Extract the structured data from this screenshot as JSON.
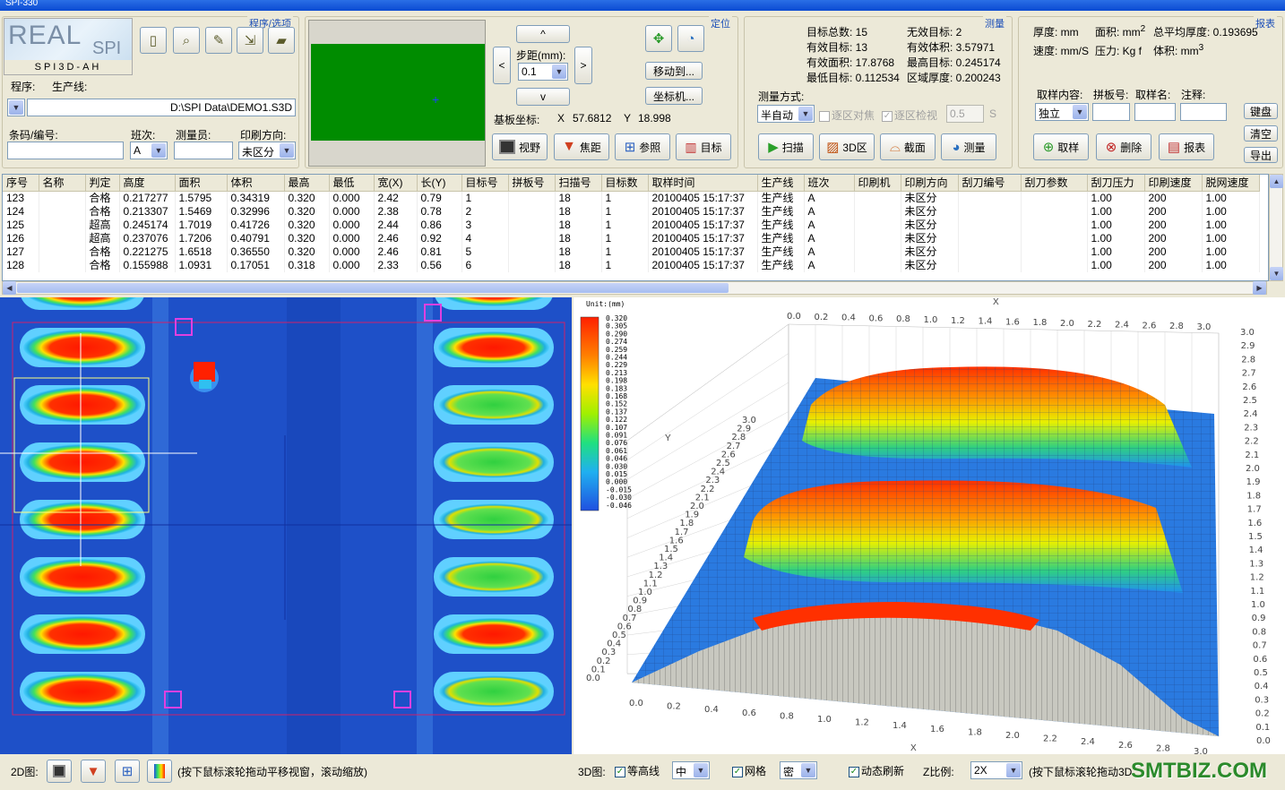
{
  "window": {
    "title": "SPI-330"
  },
  "program": {
    "group_title": "程序/选项",
    "logo_top": "REAL",
    "logo_small": "SPI",
    "model": "SPI3D-AH",
    "program_label": "程序:",
    "line_label": "生产线:",
    "path": "D:\\SPI Data\\DEMO1.S3D",
    "barcode_label": "条码/编号:",
    "shift_label": "班次:",
    "shift_value": "A",
    "operator_label": "测量员:",
    "print_dir_label": "印刷方向:",
    "print_dir_value": "未区分"
  },
  "position": {
    "group_title": "定位",
    "up": "^",
    "down": "v",
    "left": "<",
    "right": ">",
    "step_label": "步距(mm):",
    "step_value": "0.1",
    "move_to": "移动到...",
    "coord_machine": "坐标机...",
    "board_coord_label": "基板坐标:",
    "x_label": "X",
    "x_value": "57.6812",
    "y_label": "Y",
    "y_value": "18.998",
    "btn_view": "视野",
    "btn_focus": "焦距",
    "btn_ref": "参照",
    "btn_target": "目标"
  },
  "measure": {
    "group_title": "测量",
    "total_targets": "目标总数: 15",
    "invalid_targets": "无效目标: 2",
    "valid_targets": "有效目标: 13",
    "valid_volume": "有效体积: 3.57971",
    "valid_area": "有效面积: 17.8768",
    "max_target": "最高目标: 0.245174",
    "min_target": "最低目标: 0.112534",
    "region_thickness": "区域厚度: 0.200243",
    "mode_label": "测量方式:",
    "mode_value": "半自动",
    "chk_region_focus": "逐区对焦",
    "chk_region_check": "逐区检视",
    "time_value": "0.5",
    "time_unit": "S",
    "btn_scan": "扫描",
    "btn_3d": "3D区",
    "btn_section": "截面",
    "btn_measure": "测量"
  },
  "report": {
    "group_title": "报表",
    "thickness": "厚度: mm",
    "area": "面积: mm",
    "area_sup": "2",
    "avg_thickness": "总平均厚度: 0.193695",
    "speed": "速度: mm/S",
    "pressure": "压力: Kg f",
    "volume": "体积: mm",
    "volume_sup": "3",
    "sample_content_label": "取样内容:",
    "sample_content_value": "独立",
    "panel_no_label": "拼板号:",
    "sample_name_label": "取样名:",
    "note_label": "注释:",
    "btn_keyboard": "键盘",
    "btn_clear": "清空",
    "btn_export": "导出",
    "btn_sample": "取样",
    "btn_delete": "删除",
    "btn_report": "报表"
  },
  "table": {
    "columns": [
      "序号",
      "名称",
      "判定",
      "高度",
      "面积",
      "体积",
      "最高",
      "最低",
      "宽(X)",
      "长(Y)",
      "目标号",
      "拼板号",
      "扫描号",
      "目标数",
      "取样时间",
      "生产线",
      "班次",
      "印刷机",
      "印刷方向",
      "刮刀编号",
      "刮刀参数",
      "刮刀压力",
      "印刷速度",
      "脱网速度"
    ],
    "rows": [
      [
        "123",
        "",
        "合格",
        "0.217277",
        "1.5795",
        "0.34319",
        "0.320",
        "0.000",
        "2.42",
        "0.79",
        "1",
        "",
        "18",
        "1",
        "20100405 15:17:37",
        "生产线",
        "A",
        "",
        "未区分",
        "",
        "",
        "1.00",
        "200",
        "1.00"
      ],
      [
        "124",
        "",
        "合格",
        "0.213307",
        "1.5469",
        "0.32996",
        "0.320",
        "0.000",
        "2.38",
        "0.78",
        "2",
        "",
        "18",
        "1",
        "20100405 15:17:37",
        "生产线",
        "A",
        "",
        "未区分",
        "",
        "",
        "1.00",
        "200",
        "1.00"
      ],
      [
        "125",
        "",
        "超高",
        "0.245174",
        "1.7019",
        "0.41726",
        "0.320",
        "0.000",
        "2.44",
        "0.86",
        "3",
        "",
        "18",
        "1",
        "20100405 15:17:37",
        "生产线",
        "A",
        "",
        "未区分",
        "",
        "",
        "1.00",
        "200",
        "1.00"
      ],
      [
        "126",
        "",
        "超高",
        "0.237076",
        "1.7206",
        "0.40791",
        "0.320",
        "0.000",
        "2.46",
        "0.92",
        "4",
        "",
        "18",
        "1",
        "20100405 15:17:37",
        "生产线",
        "A",
        "",
        "未区分",
        "",
        "",
        "1.00",
        "200",
        "1.00"
      ],
      [
        "127",
        "",
        "合格",
        "0.221275",
        "1.6518",
        "0.36550",
        "0.320",
        "0.000",
        "2.46",
        "0.81",
        "5",
        "",
        "18",
        "1",
        "20100405 15:17:37",
        "生产线",
        "A",
        "",
        "未区分",
        "",
        "",
        "1.00",
        "200",
        "1.00"
      ],
      [
        "128",
        "",
        "合格",
        "0.155988",
        "1.0931",
        "0.17051",
        "0.318",
        "0.000",
        "2.33",
        "0.56",
        "6",
        "",
        "18",
        "1",
        "20100405 15:17:37",
        "生产线",
        "A",
        "",
        "未区分",
        "",
        "",
        "1.00",
        "200",
        "1.00"
      ]
    ]
  },
  "legend": {
    "unit": "Unit:(mm)",
    "values": [
      "0.320",
      "0.305",
      "0.290",
      "0.274",
      "0.259",
      "0.244",
      "0.229",
      "0.213",
      "0.198",
      "0.183",
      "0.168",
      "0.152",
      "0.137",
      "0.122",
      "0.107",
      "0.091",
      "0.076",
      "0.061",
      "0.046",
      "0.030",
      "0.015",
      "0.000",
      "-0.015",
      "-0.030",
      "-0.046"
    ]
  },
  "axes3d": {
    "x_label": "X",
    "y_label": "Y",
    "x_ticks": [
      "0.0",
      "0.2",
      "0.4",
      "0.6",
      "0.8",
      "1.0",
      "1.2",
      "1.4",
      "1.6",
      "1.8",
      "2.0",
      "2.2",
      "2.4",
      "2.6",
      "2.8",
      "3.0"
    ],
    "y_ticks": [
      "0.0",
      "0.1",
      "0.2",
      "0.3",
      "0.4",
      "0.5",
      "0.6",
      "0.7",
      "0.8",
      "0.9",
      "1.0",
      "1.1",
      "1.2",
      "1.3",
      "1.4",
      "1.5",
      "1.6",
      "1.7",
      "1.8",
      "1.9",
      "2.0",
      "2.1",
      "2.2",
      "2.3",
      "2.4",
      "2.5",
      "2.6",
      "2.7",
      "2.8",
      "2.9",
      "3.0"
    ]
  },
  "status": {
    "label_2d": "2D图:",
    "hint_2d": "(按下鼠标滚轮拖动平移视窗，滚动缩放)",
    "label_3d": "3D图:",
    "chk_contour": "等高线",
    "contour_value": "中",
    "chk_mesh": "网格",
    "mesh_value": "密",
    "chk_refresh": "动态刷新",
    "z_ratio_label": "Z比例:",
    "z_ratio_value": "2X",
    "hint_3d": "(按下鼠标滚轮拖动3D",
    "watermark": "SMTBIZ.COM"
  },
  "colors": {
    "accent": "#1c4fb8",
    "pad_green": "#008c00",
    "board_blue": "#1e4fc8"
  }
}
